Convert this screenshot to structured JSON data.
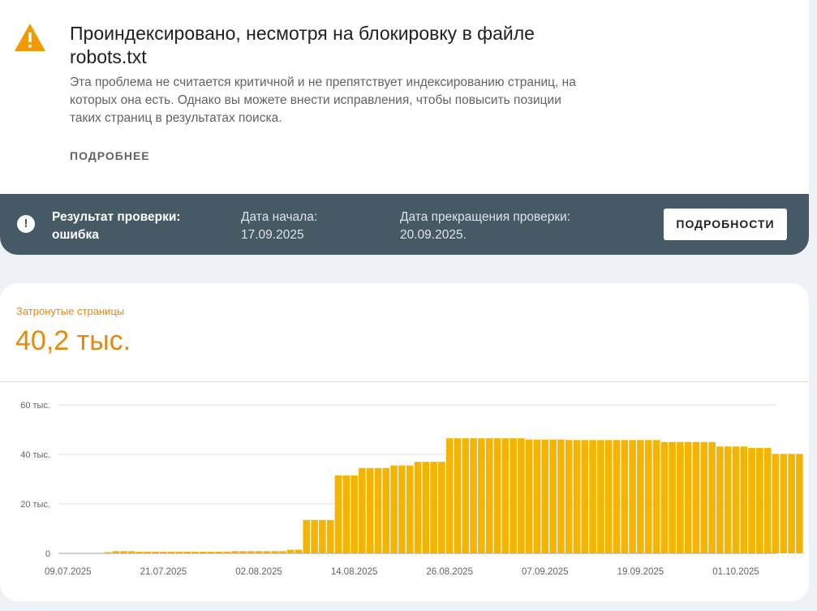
{
  "issue": {
    "title": "Проиндексировано, несмотря на блокировку в файле robots.txt",
    "description": "Эта проблема не считается критичной и не препятствует индексированию страниц, на которых она есть. Однако вы можете внести исправления, чтобы повысить позиции таких страниц в результатах поиска.",
    "more_label": "ПОДРОБНЕЕ",
    "icon": "warning-triangle-icon"
  },
  "validation": {
    "icon": "error-circle-icon",
    "result_label": "Результат проверки: ошибка",
    "start_label": "Дата начала: 17.09.2025",
    "stop_label": "Дата прекращения проверки: 20.09.2025.",
    "details_button": "ПОДРОБНОСТИ"
  },
  "affected": {
    "label": "Затронутые страницы",
    "value": "40,2 тыс."
  },
  "colors": {
    "bar": "#f4b400",
    "accent": "#e8890c",
    "banner": "#455a64"
  },
  "chart_data": {
    "type": "bar",
    "ylim": [
      0,
      60000
    ],
    "y_ticks": [
      {
        "value": 0,
        "label": "0"
      },
      {
        "value": 20000,
        "label": "20 тыс."
      },
      {
        "value": 40000,
        "label": "40 тыс."
      },
      {
        "value": 60000,
        "label": "60 тыс."
      }
    ],
    "x_tick_labels": [
      "09.07.2025",
      "21.07.2025",
      "02.08.2025",
      "14.08.2025",
      "26.08.2025",
      "07.09.2025",
      "19.09.2025",
      "01.10.2025"
    ],
    "x_tick_every": 12,
    "grid": true,
    "values": [
      0,
      0,
      0,
      0,
      0,
      500,
      900,
      900,
      900,
      700,
      700,
      700,
      700,
      700,
      700,
      700,
      700,
      700,
      700,
      700,
      700,
      900,
      900,
      900,
      900,
      900,
      900,
      900,
      1500,
      1500,
      13500,
      13500,
      13500,
      13500,
      31500,
      31500,
      31500,
      34500,
      34500,
      34500,
      34500,
      35500,
      35500,
      35500,
      37000,
      37000,
      37000,
      37000,
      46500,
      46500,
      46500,
      46500,
      46500,
      46500,
      46500,
      46500,
      46500,
      46500,
      46000,
      46000,
      46000,
      46000,
      46000,
      45800,
      45800,
      45800,
      45800,
      45800,
      45800,
      45800,
      45800,
      45800,
      45800,
      45800,
      45800,
      45000,
      45000,
      45000,
      45000,
      45000,
      45000,
      45000,
      43200,
      43200,
      43200,
      43200,
      42600,
      42600,
      42600,
      40200,
      40200,
      40200,
      40200
    ]
  }
}
